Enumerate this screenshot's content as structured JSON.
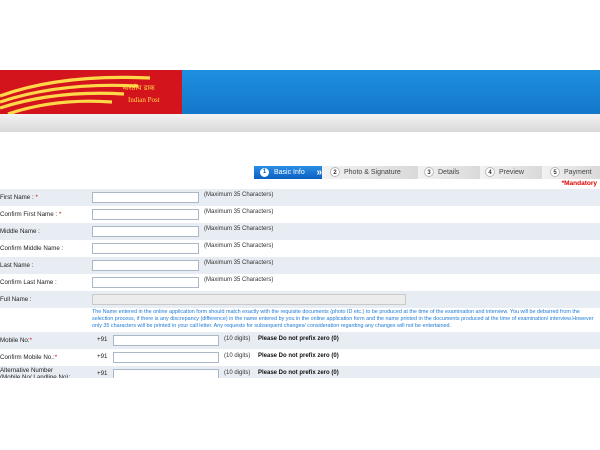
{
  "logo": {
    "hindi": "भारतीय डाक",
    "english": "Indian Post",
    "icon": "post-horn-logo"
  },
  "colors": {
    "banner": "#1477c9",
    "logo_bg": "#d4141c",
    "logo_stripes": "#ffd84a",
    "active_step": "#0b5fbf",
    "notice": "#1d7ad6",
    "required": "#dd0000",
    "row_alt": "#e8edf3"
  },
  "steps": [
    {
      "num": "1",
      "label": "Basic Info",
      "active": true
    },
    {
      "num": "2",
      "label": "Photo & Signature",
      "active": false
    },
    {
      "num": "3",
      "label": "Details",
      "active": false
    },
    {
      "num": "4",
      "label": "Preview",
      "active": false
    },
    {
      "num": "5",
      "label": "Payment",
      "active": false
    }
  ],
  "mandatory_note": "*Mandatory",
  "fields": {
    "first_name": {
      "label": "First Name :",
      "req": "*",
      "hint": "(Maximum 35 Characters)",
      "value": ""
    },
    "confirm_first_name": {
      "label": "Confirm First Name :",
      "req": "*",
      "hint": "(Maximum 35 Characters)",
      "value": ""
    },
    "middle_name": {
      "label": "Middle Name :",
      "hint": "(Maximum 35 Characters)",
      "value": ""
    },
    "confirm_middle_name": {
      "label": "Confirm Middle Name :",
      "hint": "(Maximum 35 Characters)",
      "value": ""
    },
    "last_name": {
      "label": "Last Name :",
      "hint": "(Maximum 35 Characters)",
      "value": ""
    },
    "confirm_last_name": {
      "label": "Confirm Last Name :",
      "hint": "(Maximum 35 Characters)",
      "value": ""
    },
    "full_name": {
      "label": "Full Name :",
      "value": ""
    }
  },
  "notice": "The Name entered in the online application form should match exactly with the requisite documents (photo ID etc.) to be produced at the time of the examination and interview. You will be debarred from the selection process, if there is any discrepancy (difference) in the name entered by you in the online application form and the name printed in the documents produced at the time of examination/ interview.However only 35 characters will be printed in your call letter. Any requests for subsequent changes/ consideration regarding any changes will not be entertained.",
  "mobile": {
    "mobile_no": {
      "label": "Mobile No:",
      "req": "*",
      "prefix": "+91",
      "digits": "(10 digits)",
      "warning": "Please Do not prefix zero (0)",
      "value": ""
    },
    "confirm_mobile_no": {
      "label": "Confirm Mobile No.:",
      "req": "*",
      "prefix": "+91",
      "digits": "(10 digits)",
      "warning": "Please Do not prefix zero (0)",
      "value": ""
    },
    "alt_number": {
      "label1": "Alternative Number",
      "label2": "(Mobile No/ Landline No):",
      "prefix": "+91",
      "digits": "(10 digits)",
      "warning": "Please Do not prefix zero (0)",
      "value": ""
    }
  }
}
